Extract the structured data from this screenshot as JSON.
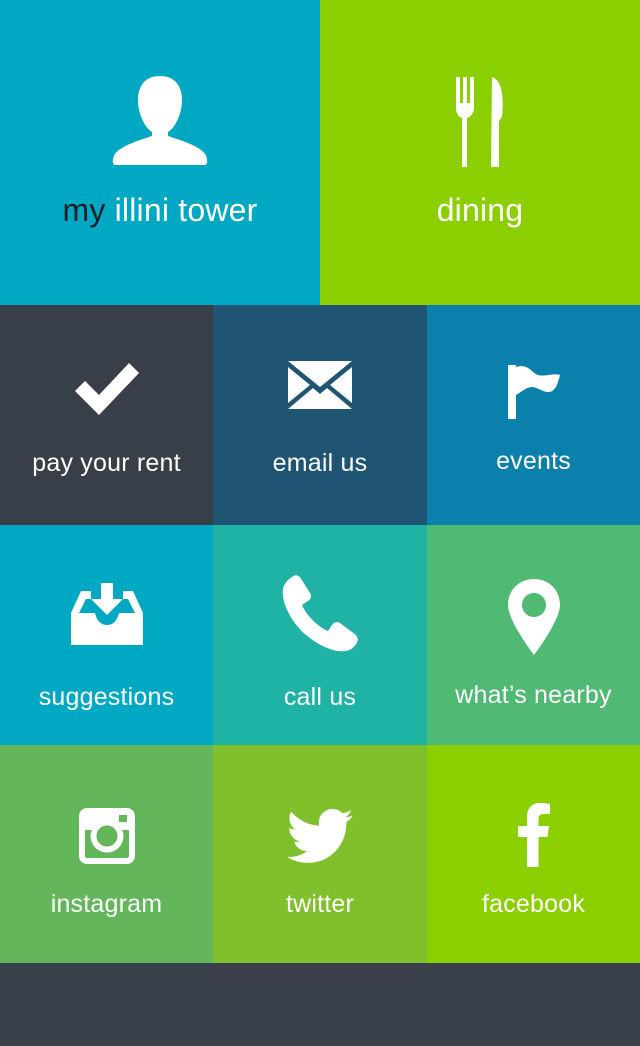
{
  "tiles": {
    "my_illini_tower": {
      "label_my": "my",
      "label_rest": " illini tower",
      "icon": "user-icon",
      "color": "#01a8c4"
    },
    "dining": {
      "label": "dining",
      "icon": "fork-knife-icon",
      "color": "#8ccf00"
    },
    "pay_rent": {
      "label": "pay your rent",
      "icon": "checkmark-icon",
      "color": "#393f49"
    },
    "email_us": {
      "label": "email us",
      "icon": "envelope-icon",
      "color": "#1f5572"
    },
    "events": {
      "label": "events",
      "icon": "flag-icon",
      "color": "#0c80ad"
    },
    "suggestions": {
      "label": "suggestions",
      "icon": "inbox-download-icon",
      "color": "#01a8c4"
    },
    "call_us": {
      "label": "call us",
      "icon": "phone-icon",
      "color": "#1fb3a5"
    },
    "whats_nearby": {
      "label": "what’s nearby",
      "icon": "map-pin-icon",
      "color": "#50b974"
    },
    "instagram": {
      "label": "instagram",
      "icon": "instagram-icon",
      "color": "#64b65b"
    },
    "twitter": {
      "label": "twitter",
      "icon": "twitter-bird-icon",
      "color": "#80c02c"
    },
    "facebook": {
      "label": "facebook",
      "icon": "facebook-icon",
      "color": "#8ccf00"
    }
  },
  "footer": {
    "color": "#394049"
  }
}
